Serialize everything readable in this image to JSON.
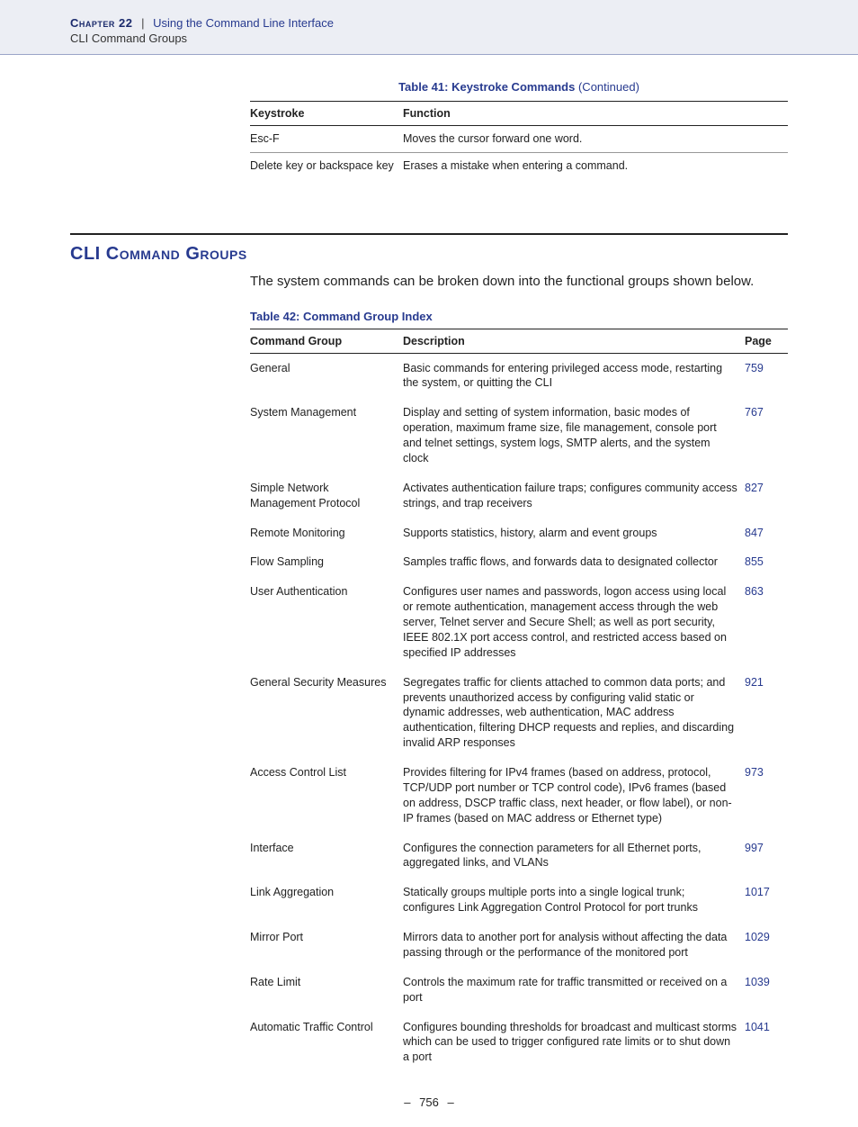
{
  "header": {
    "chapter_label": "Chapter 22",
    "separator": "|",
    "chapter_title": "Using the Command Line Interface",
    "subhead": "CLI Command Groups"
  },
  "table41": {
    "caption_main": "Table 41: Keystroke Commands",
    "caption_cont": " (Continued)",
    "col1": "Keystroke",
    "col2": "Function",
    "rows": [
      {
        "key": "Esc-F",
        "func": "Moves the cursor forward one word."
      },
      {
        "key": "Delete key or backspace key",
        "func": "Erases a mistake when entering a command."
      }
    ]
  },
  "section": {
    "title": "CLI Command Groups",
    "body": "The system commands can be broken down into the functional groups shown below."
  },
  "table42": {
    "caption": "Table 42: Command Group Index",
    "col1": "Command Group",
    "col2": "Description",
    "col3": "Page",
    "rows": [
      {
        "group": "General",
        "desc": "Basic commands for entering privileged access mode, restarting the system, or quitting the CLI",
        "page": "759"
      },
      {
        "group": "System Management",
        "desc": "Display and setting of system information, basic modes of operation, maximum frame size, file management, console port and telnet settings, system logs, SMTP alerts, and the system clock",
        "page": "767"
      },
      {
        "group": "Simple Network Management Protocol",
        "desc": "Activates authentication failure traps; configures community access strings, and trap receivers",
        "page": "827"
      },
      {
        "group": "Remote Monitoring",
        "desc": "Supports statistics, history, alarm and event groups",
        "page": "847"
      },
      {
        "group": "Flow Sampling",
        "desc": "Samples traffic flows, and forwards data to designated collector",
        "page": "855"
      },
      {
        "group": "User Authentication",
        "desc": "Configures user names and passwords, logon access using local or remote authentication, management access through the web server, Telnet server and Secure Shell; as well as port security, IEEE 802.1X port access control, and restricted access based on specified IP addresses",
        "page": "863"
      },
      {
        "group": "General Security Measures",
        "desc": "Segregates traffic for clients attached to common data ports; and prevents unauthorized access by configuring valid static or dynamic addresses, web authentication, MAC address authentication, filtering DHCP requests and replies, and discarding invalid ARP responses",
        "page": "921"
      },
      {
        "group": "Access Control List",
        "desc": "Provides filtering for IPv4 frames (based on address, protocol, TCP/UDP port number or TCP control code), IPv6 frames (based on address, DSCP traffic class, next header, or flow label), or non-IP frames (based on MAC address or Ethernet type)",
        "page": "973"
      },
      {
        "group": "Interface",
        "desc": "Configures the connection parameters for all Ethernet ports, aggregated links, and VLANs",
        "page": "997"
      },
      {
        "group": "Link Aggregation",
        "desc": "Statically groups multiple ports into a single logical trunk; configures Link Aggregation Control Protocol for port trunks",
        "page": "1017"
      },
      {
        "group": "Mirror Port",
        "desc": "Mirrors data to another port for analysis without affecting the data passing through or the performance of the monitored port",
        "page": "1029"
      },
      {
        "group": "Rate Limit",
        "desc": "Controls the maximum rate for traffic transmitted or received on a port",
        "page": "1039"
      },
      {
        "group": "Automatic Traffic Control",
        "desc": "Configures bounding thresholds for broadcast and multicast storms which can be used to trigger configured rate limits or to shut down a port",
        "page": "1041"
      }
    ]
  },
  "footer": {
    "page": "756"
  }
}
